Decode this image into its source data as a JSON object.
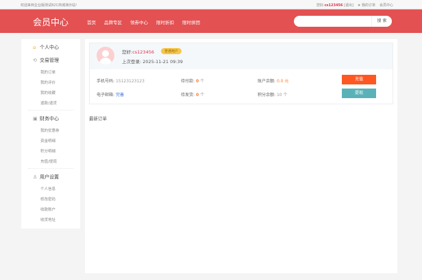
{
  "topbar": {
    "welcome": "欢迎来到企业版测试B2C商城演示站!",
    "greeting": "您好:",
    "username": "cs123456",
    "logout": "[退出]",
    "orders": "★ 我的订单",
    "member": "会员中心"
  },
  "header": {
    "logo": "会员中心",
    "nav": [
      "首页",
      "品牌专区",
      "领券中心",
      "限时折扣",
      "限时拼团"
    ],
    "search_placeholder": "",
    "search_button": "搜 索"
  },
  "sidebar": {
    "home": "个人中心",
    "sections": [
      {
        "title": "交易管理",
        "icon": "exchange-icon",
        "items": [
          "我的订单",
          "我的评价",
          "我的收藏",
          "退款/退货"
        ]
      },
      {
        "title": "财务中心",
        "icon": "wallet-icon",
        "items": [
          "我的优惠券",
          "资金明细",
          "积分明细",
          "充值/提现"
        ]
      },
      {
        "title": "用户设置",
        "icon": "user-icon",
        "items": [
          "个人信息",
          "修改密码",
          "收款账户",
          "收货地址"
        ]
      }
    ]
  },
  "profile": {
    "greeting": "您好:",
    "username": "cs123456",
    "level": "普通用户",
    "last_login_label": "上次登录:",
    "last_login": "2025-11-21 09:39"
  },
  "info": {
    "phone_label": "手机号码:",
    "phone": "15123123123",
    "email_label": "电子邮箱:",
    "email": "完善",
    "unpaid_label": "待付款:",
    "unpaid": "0",
    "unpaid_unit": "个",
    "unshipped_label": "待发货:",
    "unshipped": "0",
    "unshipped_unit": "个",
    "balance_label": "账户余额:",
    "balance": "0.0 元",
    "points_label": "积分余额:",
    "points": "10 个",
    "recharge": "充值",
    "withdraw": "提现"
  },
  "latest_orders": "最新订单",
  "colors": {
    "header": "#e35152",
    "accent": "#e0304a",
    "recharge": "#ff5722",
    "withdraw": "#5ab2b8"
  }
}
